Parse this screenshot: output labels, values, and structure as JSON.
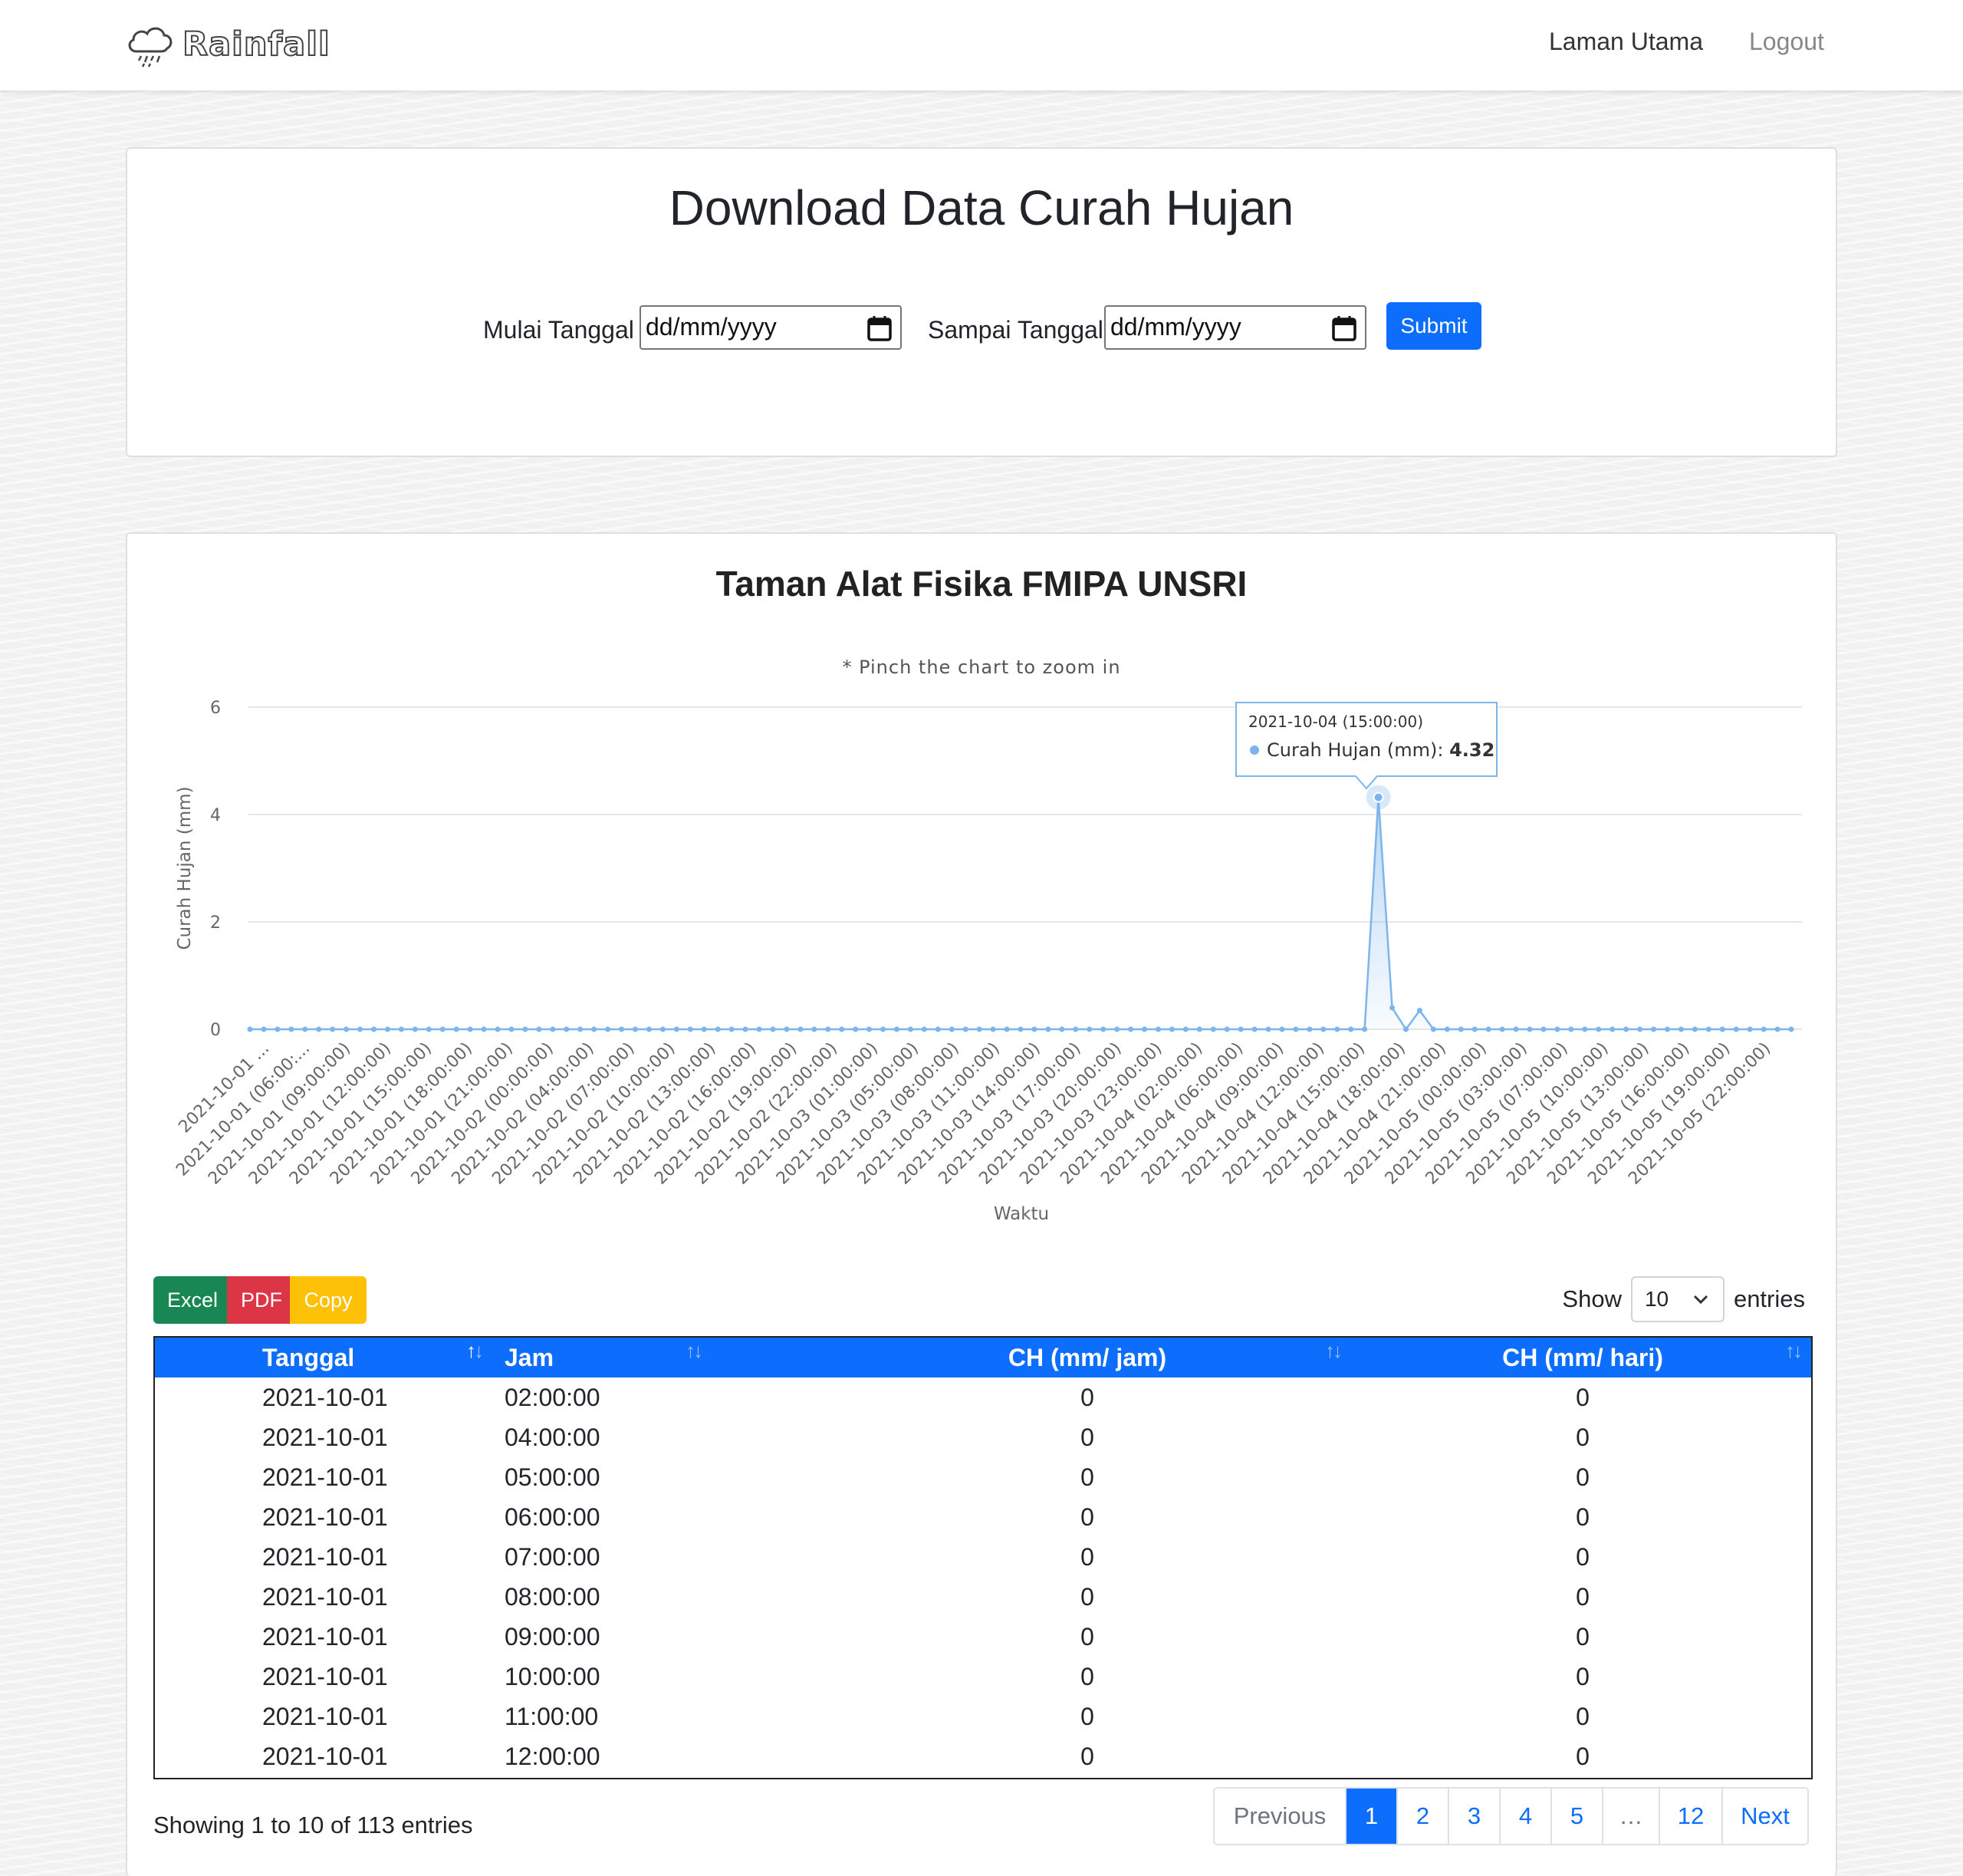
{
  "navbar": {
    "brand": "Rainfall",
    "links": {
      "home": "Laman Utama",
      "logout": "Logout"
    }
  },
  "download": {
    "title": "Download Data Curah Hujan",
    "start_label": "Mulai Tanggal",
    "end_label": "Sampai Tanggal",
    "start_value": "dd/mm/yyyy",
    "end_value": "dd/mm/yyyy",
    "submit_label": "Submit"
  },
  "chart_section": {
    "title": "Taman Alat Fisika FMIPA UNSRI",
    "note": "* Pinch the chart to zoom in"
  },
  "chart_data": {
    "type": "area",
    "ylabel": "Curah Hujan (mm)",
    "xlabel": "Waktu",
    "ylim": [
      0,
      6
    ],
    "yticks": [
      0,
      2,
      4,
      6
    ],
    "grid": true,
    "series": [
      {
        "name": "Curah Hujan (mm)",
        "color": "#7cb5ec",
        "n_points": 113,
        "values_sparse": {
          "82": 4.32,
          "83": 0.4,
          "85": 0.35
        }
      }
    ],
    "tick_labels": [
      "2021-10-01 ...",
      "2021-10-01 (06:00:...",
      "2021-10-01 (09:00:00)",
      "2021-10-01 (12:00:00)",
      "2021-10-01 (15:00:00)",
      "2021-10-01 (18:00:00)",
      "2021-10-01 (21:00:00)",
      "2021-10-02 (00:00:00)",
      "2021-10-02 (04:00:00)",
      "2021-10-02 (07:00:00)",
      "2021-10-02 (10:00:00)",
      "2021-10-02 (13:00:00)",
      "2021-10-02 (16:00:00)",
      "2021-10-02 (19:00:00)",
      "2021-10-02 (22:00:00)",
      "2021-10-03 (01:00:00)",
      "2021-10-03 (05:00:00)",
      "2021-10-03 (08:00:00)",
      "2021-10-03 (11:00:00)",
      "2021-10-03 (14:00:00)",
      "2021-10-03 (17:00:00)",
      "2021-10-03 (20:00:00)",
      "2021-10-03 (23:00:00)",
      "2021-10-04 (02:00:00)",
      "2021-10-04 (06:00:00)",
      "2021-10-04 (09:00:00)",
      "2021-10-04 (12:00:00)",
      "2021-10-04 (15:00:00)",
      "2021-10-04 (18:00:00)",
      "2021-10-04 (21:00:00)",
      "2021-10-05 (00:00:00)",
      "2021-10-05 (03:00:00)",
      "2021-10-05 (07:00:00)",
      "2021-10-05 (10:00:00)",
      "2021-10-05 (13:00:00)",
      "2021-10-05 (16:00:00)",
      "2021-10-05 (19:00:00)",
      "2021-10-05 (22:00:00)"
    ],
    "tooltip": {
      "header": "2021-10-04 (15:00:00)",
      "label": "Curah Hujan (mm)",
      "value": "4.32",
      "point_index": 82
    }
  },
  "table_controls": {
    "export_buttons": [
      "Excel",
      "PDF",
      "Copy"
    ],
    "show_label": "Show",
    "show_value": "10",
    "entries_label": "entries"
  },
  "table": {
    "headers": [
      "Tanggal",
      "Jam",
      "CH (mm/ jam)",
      "CH (mm/ hari)"
    ],
    "rows": [
      [
        "2021-10-01",
        "02:00:00",
        "0",
        "0"
      ],
      [
        "2021-10-01",
        "04:00:00",
        "0",
        "0"
      ],
      [
        "2021-10-01",
        "05:00:00",
        "0",
        "0"
      ],
      [
        "2021-10-01",
        "06:00:00",
        "0",
        "0"
      ],
      [
        "2021-10-01",
        "07:00:00",
        "0",
        "0"
      ],
      [
        "2021-10-01",
        "08:00:00",
        "0",
        "0"
      ],
      [
        "2021-10-01",
        "09:00:00",
        "0",
        "0"
      ],
      [
        "2021-10-01",
        "10:00:00",
        "0",
        "0"
      ],
      [
        "2021-10-01",
        "11:00:00",
        "0",
        "0"
      ],
      [
        "2021-10-01",
        "12:00:00",
        "0",
        "0"
      ]
    ]
  },
  "pagination": {
    "info": "Showing 1 to 10 of 113 entries",
    "previous": "Previous",
    "pages": [
      "1",
      "2",
      "3",
      "4",
      "5",
      "…",
      "12"
    ],
    "next": "Next",
    "active": "1"
  }
}
